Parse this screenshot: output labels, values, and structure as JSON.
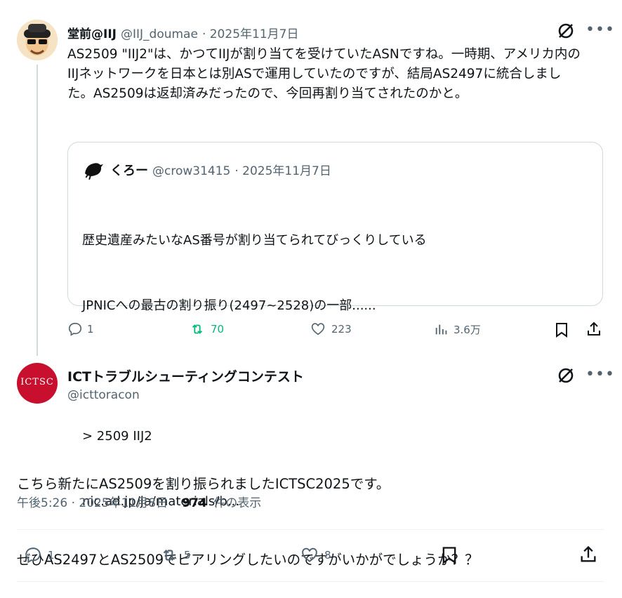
{
  "reply": {
    "name": "堂前@IIJ",
    "handle": "@IIJ_doumae",
    "date": "· 2025年11月7日",
    "text": "AS2509 \"IIJ2\"は、かつてIIJが割り当てを受けていたASNですね。一時期、アメリカ内のIIJネットワークを日本とは別ASで運用していたのですが、結局AS2497に統合しました。AS2509は返却済みだったので、今回再割り当てされたのかと。",
    "quote": {
      "name": "くろー",
      "handle": "@crow31415",
      "date": "· 2025年11月7日",
      "line1": "歴史遺産みたいなAS番号が割り当てられてびっくりしている",
      "line2": "JPNICへの最古の割り振り(2497~2528)の一部......",
      "line3": "> 2509 IIJ2",
      "line4": "nic.ad.jp/ja/materials/b..."
    },
    "stats": {
      "replies": "1",
      "reposts": "70",
      "likes": "223",
      "views": "3.6万"
    }
  },
  "main": {
    "name": "ICTトラブルシューティングコンテスト",
    "handle": "@icttoracon",
    "avatar_text": "ICTSC",
    "line1": "こちら新たにAS2509を割り振られましたICTSC2025です。",
    "line2": "ぜひAS2497とAS2509でピアリングしたいのですがいかがでしょうか？？",
    "time": "午後5:26 · 2025年11月8日 ·",
    "views": "974",
    "views_label": "件の表示",
    "stats": {
      "replies": "1",
      "reposts": "5",
      "likes": "8"
    }
  },
  "colors": {
    "repost_active": "#00ba7c",
    "muted": "#536471",
    "border": "#cfd9de",
    "avatar_red": "#c8102e"
  }
}
